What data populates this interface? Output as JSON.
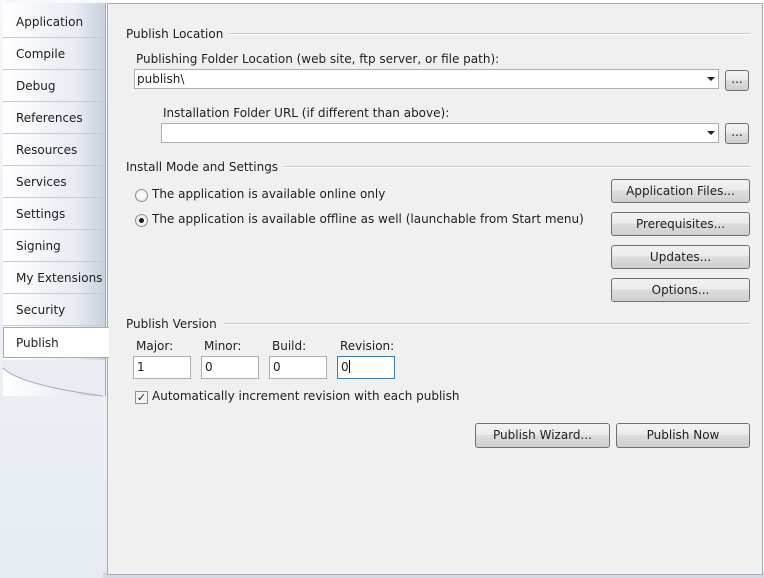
{
  "sidebar": {
    "tabs": [
      {
        "label": "Application"
      },
      {
        "label": "Compile"
      },
      {
        "label": "Debug"
      },
      {
        "label": "References"
      },
      {
        "label": "Resources"
      },
      {
        "label": "Services"
      },
      {
        "label": "Settings"
      },
      {
        "label": "Signing"
      },
      {
        "label": "My Extensions"
      },
      {
        "label": "Security"
      },
      {
        "label": "Publish",
        "selected": true
      }
    ]
  },
  "publish_location": {
    "group_title": "Publish Location",
    "folder_label": "Publishing Folder Location (web site, ftp server, or file path):",
    "folder_value": "publish\\",
    "install_url_label": "Installation Folder URL (if different than above):",
    "install_url_value": "",
    "browse_label": "..."
  },
  "install_mode": {
    "group_title": "Install Mode and Settings",
    "online_only_label": "The application is available online only",
    "offline_label": "The application is available offline as well (launchable from Start menu)",
    "selected": "offline",
    "buttons": {
      "application_files": "Application Files...",
      "prerequisites": "Prerequisites...",
      "updates": "Updates...",
      "options": "Options..."
    }
  },
  "publish_version": {
    "group_title": "Publish Version",
    "major_label": "Major:",
    "minor_label": "Minor:",
    "build_label": "Build:",
    "revision_label": "Revision:",
    "major": "1",
    "minor": "0",
    "build": "0",
    "revision": "0",
    "auto_increment_label": "Automatically increment revision with each publish",
    "auto_increment_checked": true
  },
  "actions": {
    "publish_wizard": "Publish Wizard...",
    "publish_now": "Publish Now"
  },
  "icons": {
    "dropdown": "chevron-down-icon",
    "checkmark": "check-icon"
  },
  "colors": {
    "panel_bg": "#f0f0f0",
    "border": "#a5acb5",
    "focus_border": "#3d7bad"
  }
}
